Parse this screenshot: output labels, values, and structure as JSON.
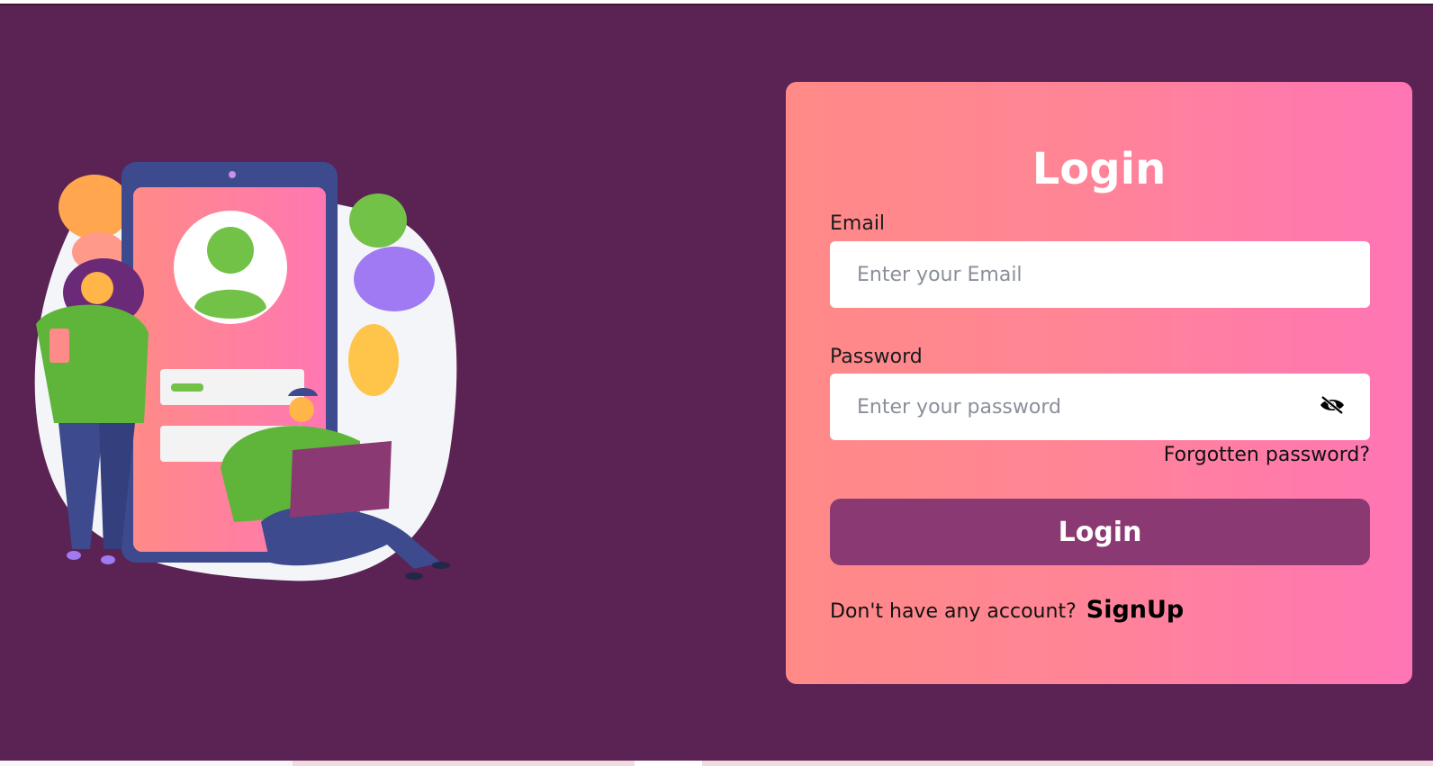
{
  "colors": {
    "page_background": "#5b2254",
    "card_gradient_start": "#ff8a87",
    "card_gradient_end": "#ff75b5",
    "button_background": "#8b3973",
    "input_background": "#ffffff"
  },
  "illustration": {
    "icon": "login-illustration"
  },
  "card": {
    "title": "Login",
    "email": {
      "label": "Email",
      "placeholder": "Enter your Email",
      "value": ""
    },
    "password": {
      "label": "Password",
      "placeholder": "Enter your password",
      "value": "",
      "toggle_icon": "eye-slash-icon"
    },
    "forgot_password": "Forgotten password?",
    "login_button": "Login",
    "signup_prompt": "Don't have any account?",
    "signup_link": "SignUp"
  }
}
